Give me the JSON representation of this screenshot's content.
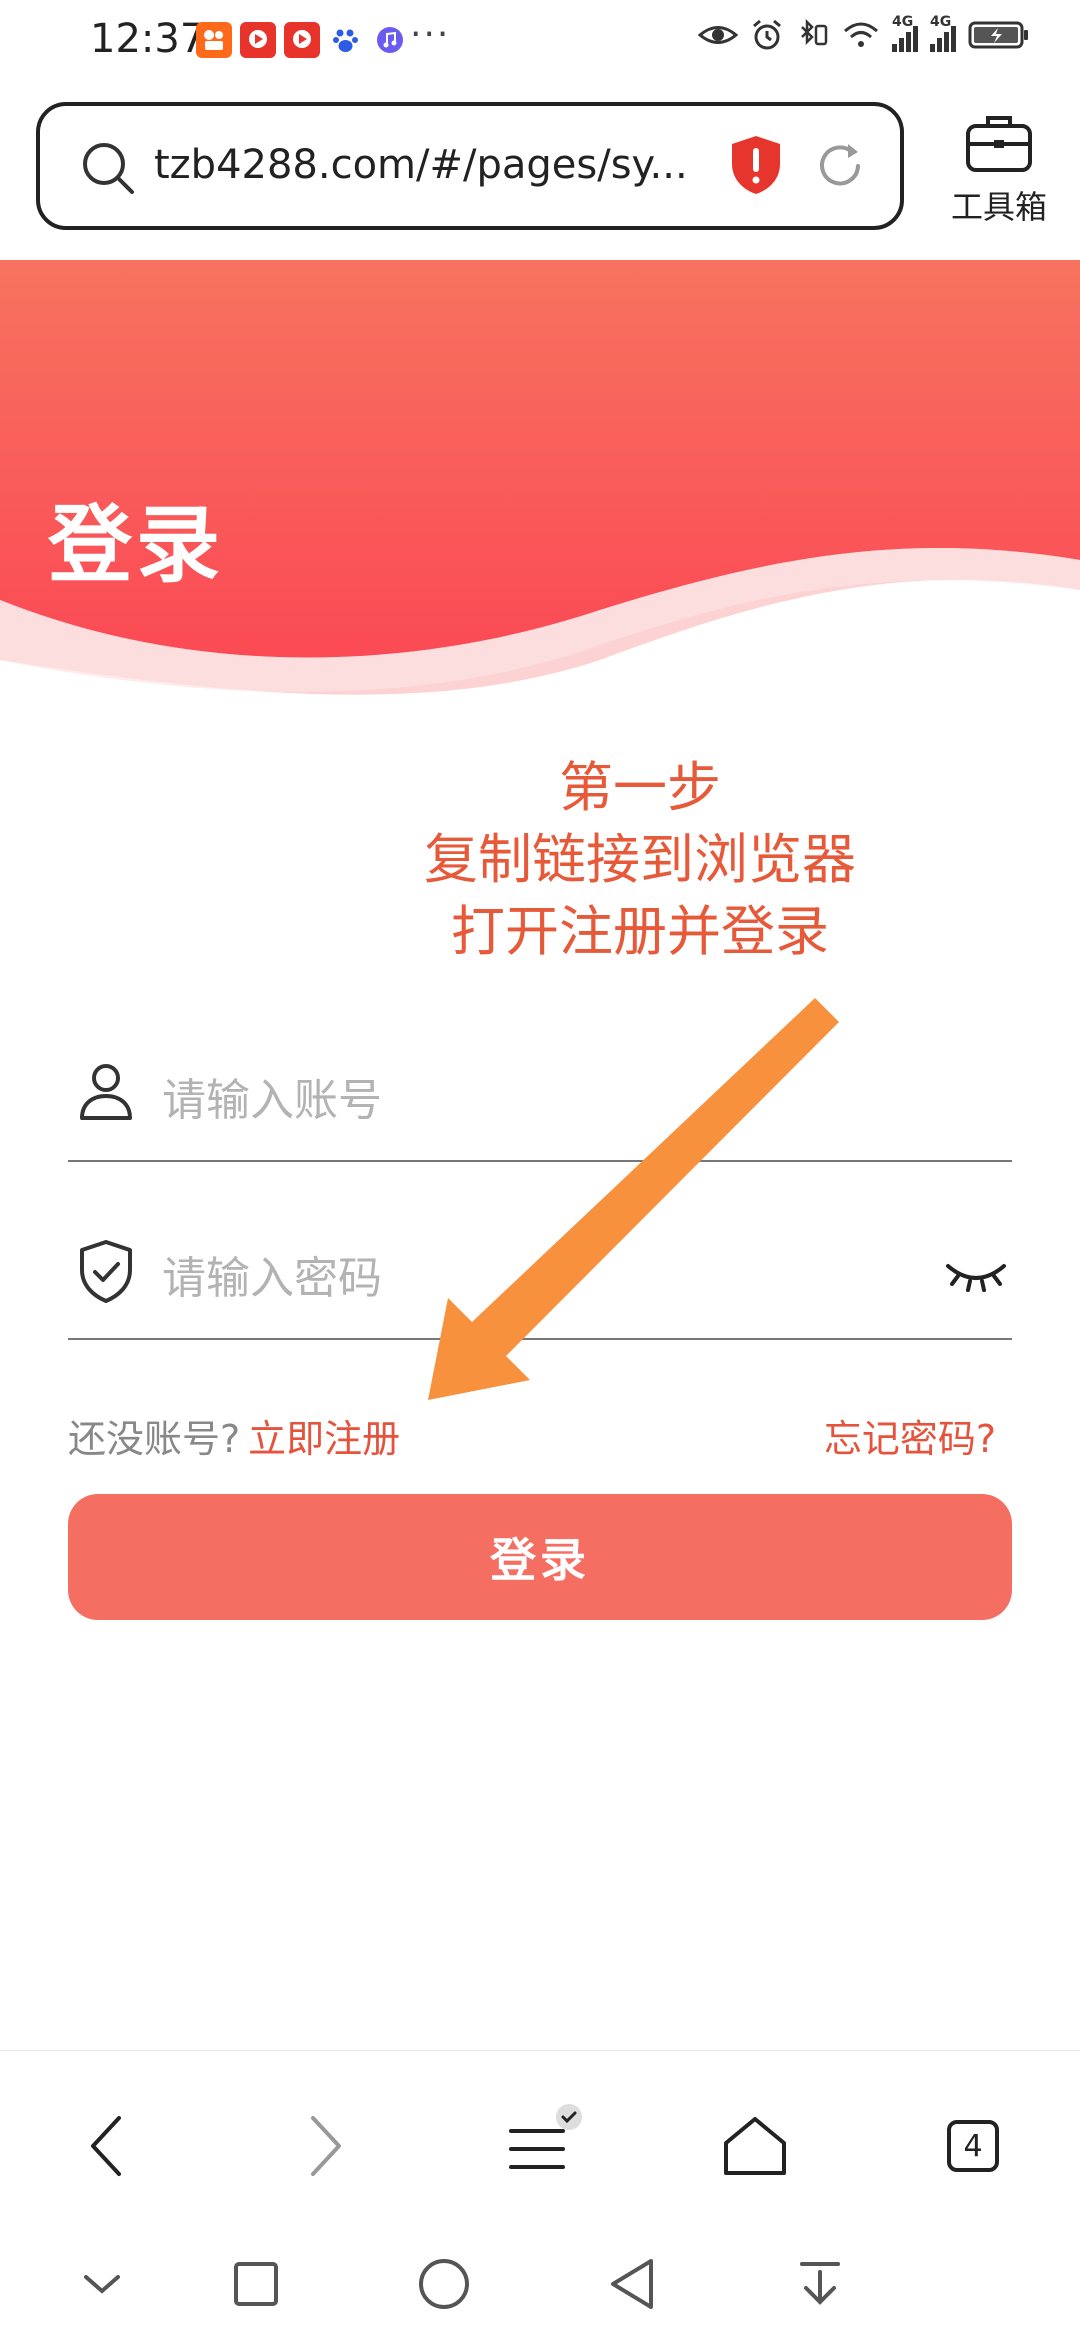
{
  "status_bar": {
    "time": "12:37",
    "more": "···",
    "network_labels": [
      "4G",
      "4G"
    ]
  },
  "browser": {
    "url": "tzb4288.com/#/pages/sy...",
    "toolbox_label": "工具箱",
    "tab_count": "4"
  },
  "page": {
    "title": "登录",
    "annotation_lines": [
      "第一步",
      "复制链接到浏览器",
      "打开注册并登录"
    ],
    "account_placeholder": "请输入账号",
    "password_placeholder": "请输入密码",
    "no_account_text": "还没账号?",
    "register_link": "立即注册",
    "forgot_link": "忘记密码?",
    "login_button": "登录"
  },
  "colors": {
    "brand": "#f46e62",
    "banner_top": "#f7735f",
    "banner_bottom": "#fb4a55",
    "annotation": "#e65a3a",
    "arrow": "#f7913e"
  }
}
